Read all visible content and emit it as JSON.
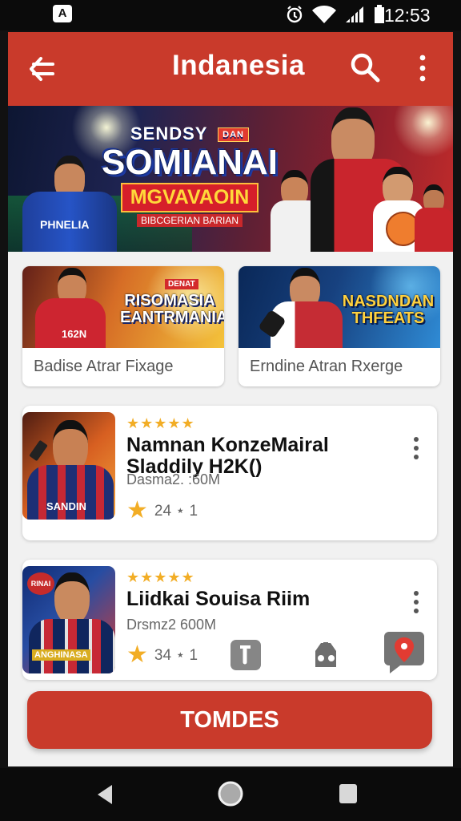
{
  "status_bar": {
    "app_icon": "A",
    "time": "12:53",
    "icons": [
      "alarm-icon",
      "wifi-icon",
      "signal-icon",
      "battery-icon"
    ]
  },
  "app_bar": {
    "title": "Indanesia",
    "back_icon": "back-arrow-icon",
    "search_icon": "search-icon",
    "more_icon": "more-vertical-icon"
  },
  "hero": {
    "top": "SENDSY",
    "badge": "DAN",
    "main": "SOMIANAI",
    "sub": "MGVAVAOIN",
    "caption": "BIBCGERIAN BARIAN",
    "jersey": "PHNELIA"
  },
  "promo_cards": [
    {
      "label": "Badise Atrar Fixage",
      "title": "RISOMASIA EANTRMANIA",
      "badge": "DENAT",
      "jersey": "162N"
    },
    {
      "label": "Erndine Atran Rxerge",
      "title": "NASDNDAN THFEATS"
    }
  ],
  "games": [
    {
      "stars": "★★★★★",
      "title": "Namnan KonzeMairal Sladdily H2K()",
      "size": "Dasma2. :60M",
      "rating": "24 ⋆ 1",
      "jersey": "SANDIN"
    },
    {
      "stars": "★★★★★",
      "title": "Liidkai Souisa Riim",
      "size": "Drsmz2 600M",
      "rating": "34 ⋆ 1",
      "badge": "RINAI",
      "jersey": "ANGHINASA"
    }
  ],
  "floating_icons": [
    "document-icon",
    "gamepad-icon",
    "map-pin-icon"
  ],
  "bottom_button": "TOMDES",
  "navigation": {
    "back_icon": "triangle-back-icon",
    "home_icon": "circle-home-icon",
    "recent_icon": "square-recent-icon"
  },
  "colors": {
    "primary": "#c93a2b",
    "surface": "#ffffff",
    "background": "#f1f1f1",
    "accent": "#f2ad25"
  }
}
